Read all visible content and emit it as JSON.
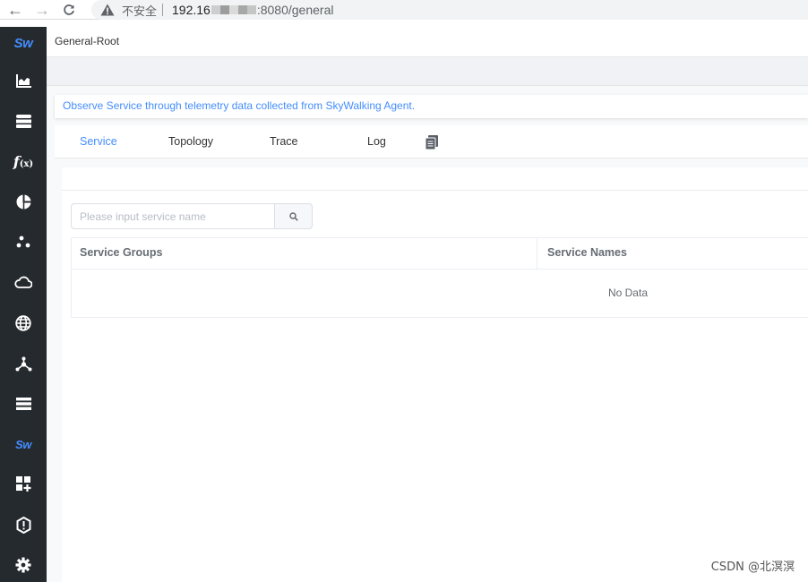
{
  "browser": {
    "back_icon": "arrow-left-icon",
    "forward_icon": "arrow-right-icon",
    "reload_icon": "reload-icon",
    "security_text": "不安全",
    "url_host": "192.16",
    "url_rest": ":8080/general"
  },
  "sidebar": {
    "logo": "Sw",
    "items": [
      {
        "icon": "chart-icon"
      },
      {
        "icon": "database-icon"
      },
      {
        "label": "f",
        "sub": "(x)",
        "icon": "function-icon"
      },
      {
        "icon": "pie-chart-icon"
      },
      {
        "icon": "dots-icon"
      },
      {
        "icon": "cloud-icon"
      },
      {
        "icon": "globe-icon"
      },
      {
        "icon": "topology-icon"
      },
      {
        "icon": "list-icon"
      },
      {
        "label": "Sw",
        "icon": "skywalking-icon"
      },
      {
        "icon": "dashboard-add-icon"
      },
      {
        "icon": "alert-icon"
      },
      {
        "icon": "settings-icon"
      }
    ]
  },
  "header": {
    "breadcrumb": "General-Root"
  },
  "main": {
    "description": "Observe Service through telemetry data collected from SkyWalking Agent.",
    "tabs": [
      {
        "label": "Service",
        "active": true
      },
      {
        "label": "Topology",
        "active": false
      },
      {
        "label": "Trace",
        "active": false
      },
      {
        "label": "Log",
        "active": false
      }
    ],
    "tab_extra_icon": "document-icon",
    "search": {
      "placeholder": "Please input service name",
      "value": ""
    },
    "table": {
      "columns": [
        "Service Groups",
        "Service Names"
      ],
      "rows": [],
      "empty_text": "No Data"
    }
  },
  "watermark": "CSDN @北溟溟",
  "colors": {
    "accent": "#448dfe",
    "sidebar": "#252a2f"
  }
}
